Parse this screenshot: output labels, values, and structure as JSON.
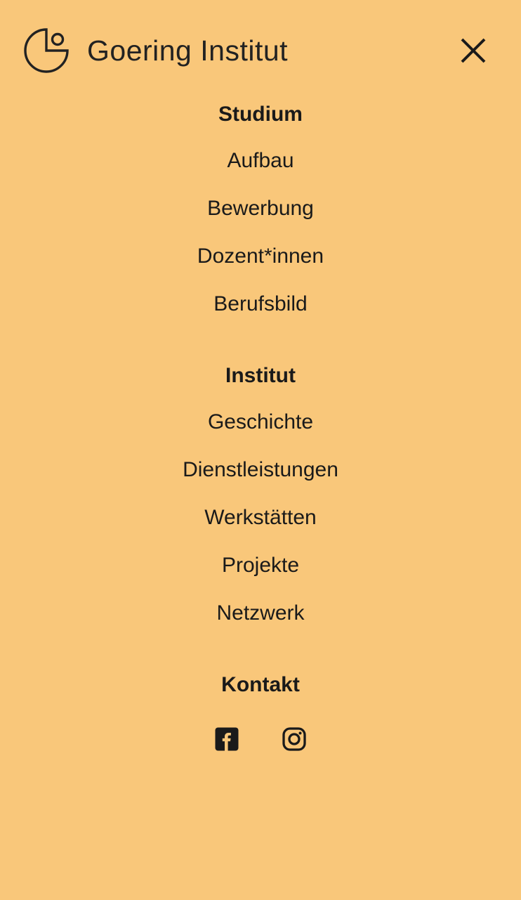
{
  "brand": {
    "name": "Goering Institut"
  },
  "close": {
    "label": "Close"
  },
  "menu": {
    "sections": [
      {
        "heading": "Studium",
        "items": [
          "Aufbau",
          "Bewerbung",
          "Dozent*innen",
          "Berufsbild"
        ]
      },
      {
        "heading": "Institut",
        "items": [
          "Geschichte",
          "Dienstleistungen",
          "Werkstätten",
          "Projekte",
          "Netzwerk"
        ]
      },
      {
        "heading": "Kontakt",
        "items": []
      }
    ]
  },
  "socials": {
    "facebook": "Facebook",
    "instagram": "Instagram"
  }
}
